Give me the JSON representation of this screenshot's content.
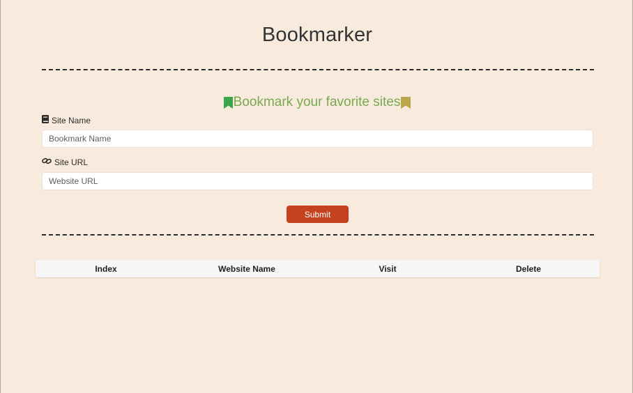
{
  "header": {
    "title": "Bookmarker"
  },
  "form": {
    "subtitle": "Bookmark your favorite sites",
    "site_name_label": "Site Name",
    "site_name_placeholder": "Bookmark Name",
    "site_url_label": "Site URL",
    "site_url_placeholder": "Website URL",
    "submit_label": "Submit"
  },
  "table": {
    "columns": [
      "Index",
      "Website Name",
      "Visit",
      "Delete"
    ],
    "rows": []
  },
  "icons": {
    "subtitle_left": "bookmark-icon",
    "subtitle_right": "bookmark-icon",
    "site_name": "book-icon",
    "site_url": "link-icon"
  },
  "colors": {
    "background": "#f8ebdd",
    "subtitle_green": "#79a851",
    "bookmark_left": "#3aa54d",
    "bookmark_right": "#bba64a",
    "submit": "#c5421f"
  }
}
